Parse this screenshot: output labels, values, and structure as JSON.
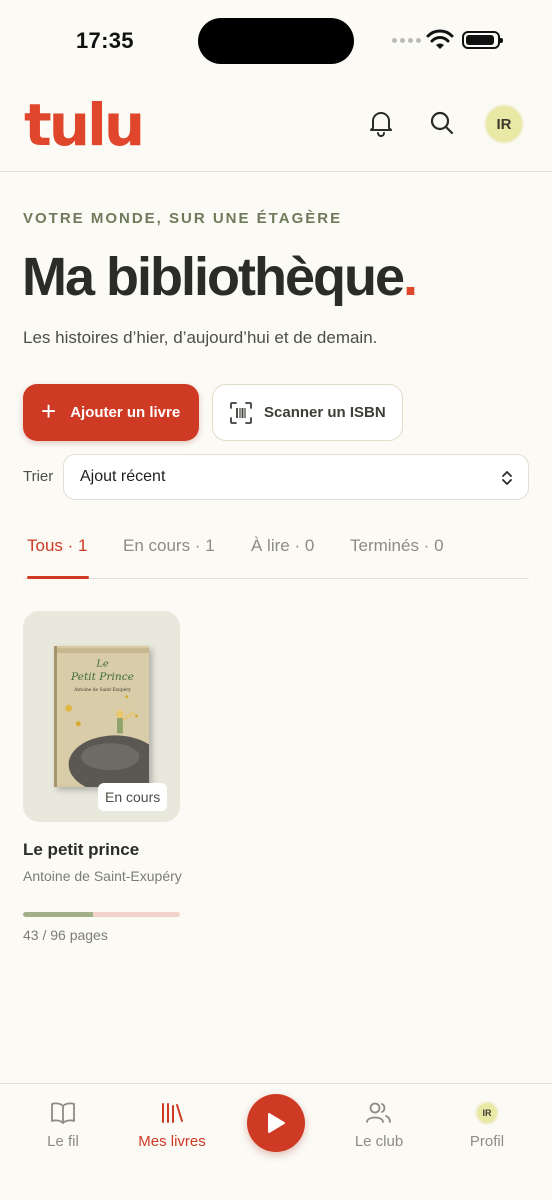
{
  "status_bar": {
    "time": "17:35"
  },
  "header": {
    "logo": "tulu",
    "avatar_initials": "IR"
  },
  "hero": {
    "eyebrow": "VOTRE MONDE, SUR UNE ÉTAGÈRE",
    "title": "Ma bibliothèque",
    "title_dot": ".",
    "subtitle": "Les histoires d’hier, d’aujourd’hui et de demain."
  },
  "actions": {
    "add_label": "Ajouter un livre",
    "scan_label": "Scanner un ISBN"
  },
  "sort": {
    "label": "Trier",
    "selected": "Ajout récent"
  },
  "tabs": [
    {
      "label": "Tous · 1",
      "active": true
    },
    {
      "label": "En cours · 1",
      "active": false
    },
    {
      "label": "À lire · 0",
      "active": false
    },
    {
      "label": "Terminés · 0",
      "active": false
    }
  ],
  "books": [
    {
      "title": "Le petit prince",
      "author": "Antoine de Saint-Exupéry",
      "status": "En cours",
      "progress_text": "43 / 96 pages",
      "pages_read": 43,
      "pages_total": 96,
      "cover": {
        "line1": "Le",
        "line2": "Petit Prince",
        "line3": "Antoine de Saint-Exupéry"
      }
    }
  ],
  "nav": [
    {
      "label": "Le fil",
      "icon": "book-open-icon",
      "active": false
    },
    {
      "label": "Mes livres",
      "icon": "library-icon",
      "active": true
    },
    {
      "label": "",
      "icon": "play-icon",
      "active": false
    },
    {
      "label": "Le club",
      "icon": "users-icon",
      "active": false
    },
    {
      "label": "Profil",
      "icon": "avatar",
      "active": false,
      "initials": "IR"
    }
  ],
  "colors": {
    "accent": "#CF3A25",
    "brand": "#E0462C",
    "progress": "#A2B08A",
    "background": "#FBFAF5"
  }
}
